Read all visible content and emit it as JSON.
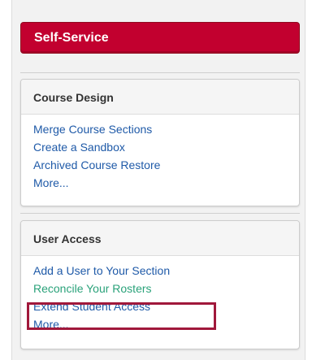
{
  "header": {
    "title": "Self-Service"
  },
  "course_design": {
    "heading": "Course Design",
    "links": [
      "Merge Course Sections",
      "Create a Sandbox",
      "Archived Course Restore",
      "More..."
    ]
  },
  "user_access": {
    "heading": "User Access",
    "links": [
      "Add a User to Your Section",
      "Reconcile Your Rosters",
      "Extend Student Access",
      "More..."
    ]
  },
  "colors": {
    "accent": "#c2002f",
    "link": "#1f5aa8",
    "visited_link": "#2aa27a",
    "highlight": "#a0183b"
  }
}
